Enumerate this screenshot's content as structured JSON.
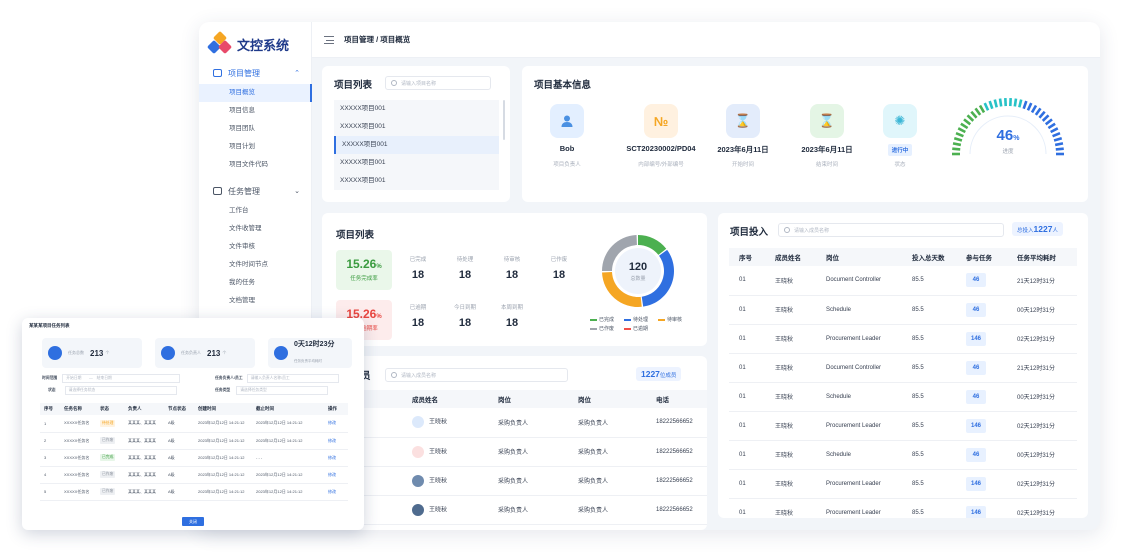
{
  "app": {
    "title": "文控系统"
  },
  "colors": {
    "accent": "#2f6fe0",
    "green": "#4cb050",
    "orange": "#f5a623",
    "gray": "#a0a5ad",
    "red": "#f0504a"
  },
  "sidebar": {
    "groups": [
      {
        "label": "项目管理",
        "icon": "folder-icon",
        "items": [
          "项目概览",
          "项目信息",
          "项目团队",
          "项目计划",
          "项目文件代码"
        ]
      },
      {
        "label": "任务管理",
        "icon": "task-icon",
        "items": [
          "工作台",
          "文件收管理",
          "文件审核",
          "文件时间节点",
          "我的任务",
          "文档管理"
        ]
      }
    ]
  },
  "breadcrumb": {
    "parent": "项目管理",
    "sep": "/",
    "current": "项目概览"
  },
  "project_list": {
    "title": "项目列表",
    "search_placeholder": "请输入项目名称",
    "items": [
      "XXXXX项目001",
      "XXXXX项目001",
      "XXXXX项目001",
      "XXXXX项目001",
      "XXXXX项目001"
    ],
    "selected_index": 2
  },
  "project_info": {
    "title": "项目基本信息",
    "cols": [
      {
        "value": "Bob",
        "label": "项目负责人",
        "icon": "user-icon"
      },
      {
        "value": "SCT20230002/PD04",
        "label": "内部编号/外部编号",
        "icon": "number-icon"
      },
      {
        "value": "2023年6月11日",
        "label": "开始时间",
        "icon": "hourglass-icon"
      },
      {
        "value": "2023年6月11日",
        "label": "结束时间",
        "icon": "hourglass-icon"
      },
      {
        "value": "进行中",
        "label": "状态",
        "icon": "status-icon"
      }
    ],
    "progress": {
      "value": "46",
      "unit": "%",
      "label": "进度",
      "fraction": 0.46
    }
  },
  "task_stats": {
    "title": "项目列表",
    "complete": {
      "value": "15.26",
      "unit": "%",
      "label": "任务完成率"
    },
    "overdue": {
      "value": "15.26",
      "unit": "%",
      "label": "任务逾期率"
    },
    "row1": [
      {
        "label": "已完成",
        "value": "18"
      },
      {
        "label": "待处理",
        "value": "18"
      },
      {
        "label": "待审核",
        "value": "18"
      },
      {
        "label": "已作废",
        "value": "18"
      }
    ],
    "row2": [
      {
        "label": "已逾期",
        "value": "18"
      },
      {
        "label": "今日到期",
        "value": "18"
      },
      {
        "label": "本周到期",
        "value": "18"
      }
    ],
    "donut": {
      "total": "120",
      "total_label": "总数量"
    },
    "legend": [
      {
        "name": "已完成",
        "color": "#4cb050"
      },
      {
        "name": "待处理",
        "color": "#2f6fe0"
      },
      {
        "name": "待审核",
        "color": "#f5a623"
      },
      {
        "name": "已作废",
        "color": "#a0a5ad"
      },
      {
        "name": "已逾期",
        "color": "#f0504a"
      }
    ]
  },
  "chart_data": {
    "type": "pie",
    "categories": [
      "已完成",
      "待处理",
      "待审核",
      "已作废"
    ],
    "values": [
      18,
      40,
      32,
      30
    ]
  },
  "members": {
    "title": "项目成员",
    "title_visible": "员",
    "search_placeholder": "请输入成员名称",
    "count": "1227",
    "count_unit": "位成员",
    "columns": [
      "成员姓名",
      "岗位",
      "岗位",
      "电话"
    ],
    "rows": [
      {
        "name": "王晓秋",
        "role": "采购负责人",
        "role2": "采购负责人",
        "phone": "18222566652"
      },
      {
        "name": "王晓秋",
        "role": "采购负责人",
        "role2": "采购负责人",
        "phone": "18222566652"
      },
      {
        "name": "王晓秋",
        "role": "采购负责人",
        "role2": "采购负责人",
        "phone": "18222566652"
      },
      {
        "name": "王晓秋",
        "role": "采购负责人",
        "role2": "采购负责人",
        "phone": "18222566652"
      }
    ]
  },
  "investment": {
    "title": "项目投入",
    "search_placeholder": "请输入成员名称",
    "total_label": "总投入",
    "total_value": "1227",
    "total_unit": "人",
    "columns": [
      "序号",
      "成员姓名",
      "岗位",
      "投入总天数",
      "参与任务",
      "任务平均耗时"
    ],
    "rows": [
      [
        "01",
        "王晓秋",
        "Document Controller",
        "85.5",
        "46",
        "21天12时31分"
      ],
      [
        "01",
        "王晓秋",
        "Schedule",
        "85.5",
        "46",
        "00天12时31分"
      ],
      [
        "01",
        "王晓秋",
        "Procurement Leader",
        "85.5",
        "146",
        "02天12时31分"
      ],
      [
        "01",
        "王晓秋",
        "Document Controller",
        "85.5",
        "46",
        "21天12时31分"
      ],
      [
        "01",
        "王晓秋",
        "Schedule",
        "85.5",
        "46",
        "00天12时31分"
      ],
      [
        "01",
        "王晓秋",
        "Procurement Leader",
        "85.5",
        "146",
        "02天12时31分"
      ],
      [
        "01",
        "王晓秋",
        "Schedule",
        "85.5",
        "46",
        "00天12时31分"
      ],
      [
        "01",
        "王晓秋",
        "Procurement Leader",
        "85.5",
        "146",
        "02天12时31分"
      ],
      [
        "01",
        "王晓秋",
        "Procurement Leader",
        "85.5",
        "146",
        "02天12时31分"
      ]
    ]
  },
  "modal": {
    "title": "某某某项目任务列表",
    "cards": [
      {
        "label": "任务总数",
        "value": "213",
        "unit": "个"
      },
      {
        "label": "任务负责人",
        "value": "213",
        "unit": "个"
      },
      {
        "label": "任务负责平均耗时",
        "value": "0天12时23分"
      }
    ],
    "filters": [
      {
        "label": "时间范围",
        "placeholder": "开始日期",
        "placeholder2": "结束日期"
      },
      {
        "label": "任务负责人/员工",
        "placeholder": "请输入负责人名称/员工"
      },
      {
        "label": "状态",
        "placeholder": "请选择任务状态"
      },
      {
        "label": "任务类型",
        "placeholder": "请选择任务类型"
      }
    ],
    "columns": [
      "序号",
      "任务名称",
      "状态",
      "负责人",
      "节点状态",
      "创建时间",
      "截止时间",
      "操作"
    ],
    "rows": [
      {
        "no": "1",
        "name": "XXXXX任务名",
        "status": "待处理",
        "owner": "某某某、某某某",
        "node": "A级",
        "created": "2023年12月12日 14:21:12",
        "deadline": "2023年12月12日 14:21:12",
        "op": "修改"
      },
      {
        "no": "2",
        "name": "XXXXX任务名",
        "status": "已作废",
        "owner": "某某某、某某某",
        "node": "A级",
        "created": "2023年12月12日 14:21:12",
        "deadline": "2023年12月12日 14:21:12",
        "op": "修改"
      },
      {
        "no": "3",
        "name": "XXXXX任务名",
        "status": "已完成",
        "owner": "某某某、某某某",
        "node": "A级",
        "created": "2023年12月12日 14:21:12",
        "deadline": "- - -",
        "op": "修改"
      },
      {
        "no": "4",
        "name": "XXXXX任务名",
        "status": "已作废",
        "owner": "某某某、某某某",
        "node": "A级",
        "created": "2023年12月12日 14:21:12",
        "deadline": "2023年12月12日 14:21:12",
        "op": "修改"
      },
      {
        "no": "5",
        "name": "XXXXX任务名",
        "status": "已作废",
        "owner": "某某某、某某某",
        "node": "A级",
        "created": "2023年12月12日 14:21:12",
        "deadline": "2023年12月12日 14:21:12",
        "op": "修改"
      }
    ],
    "close_label": "关闭"
  }
}
